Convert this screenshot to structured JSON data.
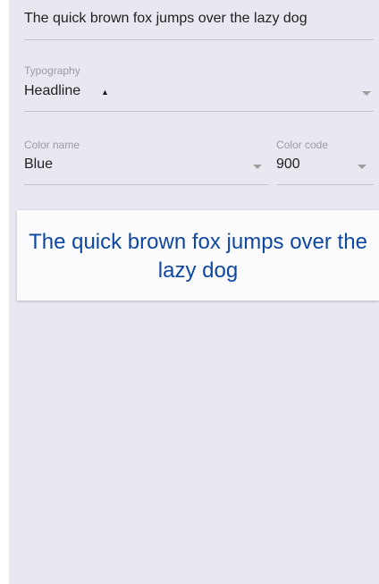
{
  "sample_text_field": {
    "value": "The quick brown fox jumps over the lazy dog"
  },
  "typography_select": {
    "label": "Typography",
    "value": "Headline",
    "icon": "dropdown-arrow-icon"
  },
  "color_name_select": {
    "label": "Color name",
    "value": "Blue",
    "icon": "dropdown-arrow-icon"
  },
  "color_code_select": {
    "label": "Color code",
    "value": "900",
    "icon": "dropdown-arrow-icon"
  },
  "preview": {
    "text": "The quick brown fox jumps over the lazy dog",
    "text_color": "#0d47a1",
    "background": "#fcfcff"
  },
  "colors": {
    "page_background": "#e8e8f0",
    "divider": "#c4c4cc",
    "label": "#9a9aa2"
  }
}
